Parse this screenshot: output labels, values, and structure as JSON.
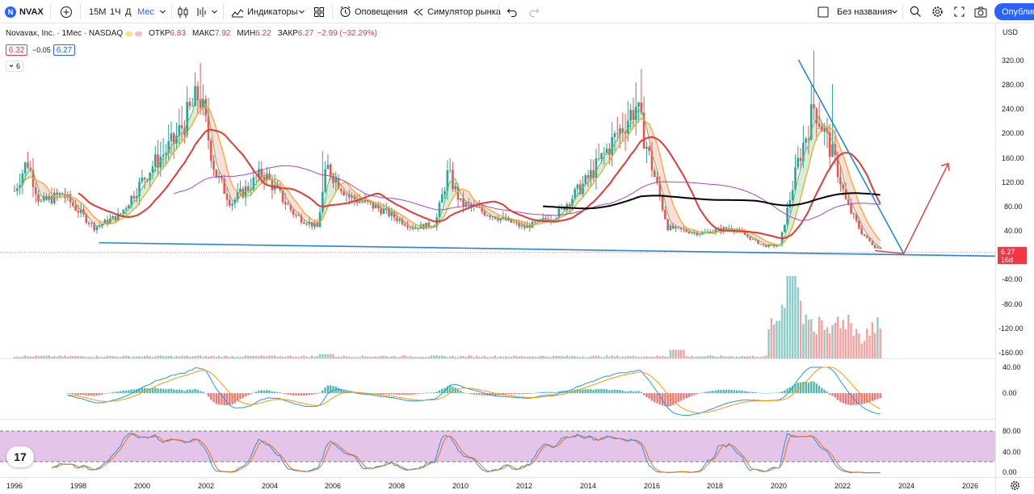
{
  "toolbar": {
    "symbol_badge": "N",
    "symbol": "NVAX",
    "intervals": [
      "15М",
      "1Ч",
      "Д",
      "Мес"
    ],
    "active_interval": "Мес",
    "indicators": "Индикаторы",
    "alerts": "Оповещения",
    "replay": "Симулятор рынка",
    "layout_name": "Без названия",
    "publish": "Опубликовать"
  },
  "legend": {
    "title": "Novavax, Inc. · 1Мес · NASDAQ",
    "open_label": "ОТКР",
    "open": "6.83",
    "high_label": "МАКС",
    "high": "7.92",
    "low_label": "МИН",
    "low": "6.22",
    "close_label": "ЗАКР",
    "close": "6.27",
    "change": "−2.99 (−32.29%)",
    "bid": "6.32",
    "spread": "−0.05",
    "ask": "6.27",
    "indicator_count": "6"
  },
  "price_axis": {
    "currency": "USD",
    "labels": [
      "320.00",
      "280.00",
      "240.00",
      "200.00",
      "160.00",
      "120.00",
      "80.00",
      "40.00",
      "-40.00",
      "-80.00",
      "-120.00",
      "-160.00"
    ],
    "last_price": "6.27",
    "countdown": "16d 12h"
  },
  "macd_axis": {
    "labels": [
      "40.00",
      "0.00",
      "-40.00"
    ]
  },
  "stoch_axis": {
    "labels": [
      "80.00",
      "40.00",
      "0.00"
    ]
  },
  "time_axis": {
    "labels": [
      "1996",
      "1998",
      "2000",
      "2002",
      "2004",
      "2006",
      "2008",
      "2010",
      "2012",
      "2014",
      "2016",
      "2018",
      "2020",
      "2022",
      "2024",
      "2026"
    ]
  },
  "logo_text": "17",
  "colors": {
    "accent": "#2962ff",
    "up": "#26a69a",
    "down": "#ef5350",
    "ma_red": "#e53935",
    "ma_black": "#000000",
    "ma_purple": "#ab47bc",
    "ma_yellow": "#f9a825",
    "stoch_band": "#e1bee7"
  },
  "chart_data": {
    "type": "candlestick",
    "symbol": "NVAX",
    "interval": "1M",
    "x_range": [
      1996,
      2026
    ],
    "y_range": [
      0,
      330
    ],
    "price_path": [
      [
        1996.0,
        100
      ],
      [
        1996.4,
        150
      ],
      [
        1996.8,
        80
      ],
      [
        1997.5,
        95
      ],
      [
        1998.5,
        40
      ],
      [
        1999.3,
        60
      ],
      [
        2000.3,
        140
      ],
      [
        2001.0,
        180
      ],
      [
        2001.8,
        260
      ],
      [
        2002.3,
        130
      ],
      [
        2002.8,
        80
      ],
      [
        2003.8,
        130
      ],
      [
        2004.8,
        60
      ],
      [
        2005.5,
        40
      ],
      [
        2005.8,
        140
      ],
      [
        2006.5,
        90
      ],
      [
        2007.5,
        70
      ],
      [
        2008.5,
        40
      ],
      [
        2009.2,
        45
      ],
      [
        2009.6,
        130
      ],
      [
        2010.0,
        80
      ],
      [
        2011.0,
        60
      ],
      [
        2012.0,
        40
      ],
      [
        2013.0,
        60
      ],
      [
        2014.0,
        120
      ],
      [
        2015.0,
        200
      ],
      [
        2015.5,
        240
      ],
      [
        2016.0,
        140
      ],
      [
        2016.5,
        40
      ],
      [
        2017.5,
        30
      ],
      [
        2018.5,
        40
      ],
      [
        2019.5,
        10
      ],
      [
        2020.0,
        10
      ],
      [
        2020.6,
        150
      ],
      [
        2021.1,
        240
      ],
      [
        2021.8,
        140
      ],
      [
        2022.1,
        80
      ],
      [
        2022.6,
        30
      ],
      [
        2023.0,
        8
      ],
      [
        2023.2,
        6.27
      ]
    ],
    "volume_peaks": [
      [
        2020.4,
        -160
      ],
      [
        2021.0,
        -90
      ],
      [
        2022.0,
        -100
      ],
      [
        2023.0,
        -80
      ]
    ]
  }
}
